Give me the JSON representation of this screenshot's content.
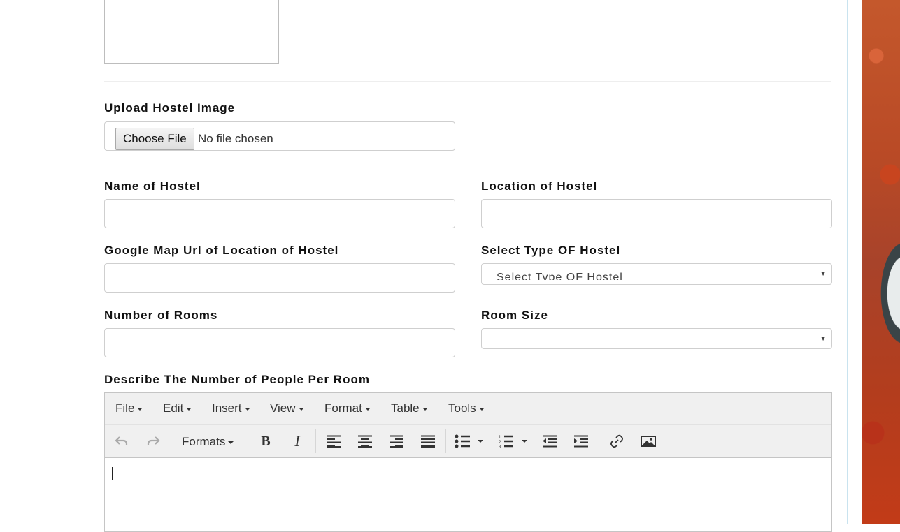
{
  "form": {
    "upload_label": "Upload Hostel Image",
    "file_button": "Choose File",
    "file_status": "No file chosen",
    "name_label": "Name of Hostel",
    "name_value": "",
    "location_label": "Location of Hostel",
    "location_value": "",
    "map_label": "Google Map Url of Location of Hostel",
    "map_value": "",
    "type_label": "Select Type OF Hostel",
    "type_selected": "Select Type OF Hostel",
    "rooms_label": "Number of Rooms",
    "rooms_value": "",
    "room_size_label": "Room Size",
    "room_size_selected": "",
    "people_label": "Describe The Number of People Per Room"
  },
  "editor": {
    "menu": [
      "File",
      "Edit",
      "Insert",
      "View",
      "Format",
      "Table",
      "Tools"
    ],
    "formats_label": "Formats",
    "toolbar_icons": [
      "undo-icon",
      "redo-icon",
      "bold-icon",
      "italic-icon",
      "align-left-icon",
      "align-center-icon",
      "align-right-icon",
      "align-justify-icon",
      "bullet-list-icon",
      "numbered-list-icon",
      "outdent-icon",
      "indent-icon",
      "link-icon",
      "image-icon"
    ],
    "content": ""
  }
}
